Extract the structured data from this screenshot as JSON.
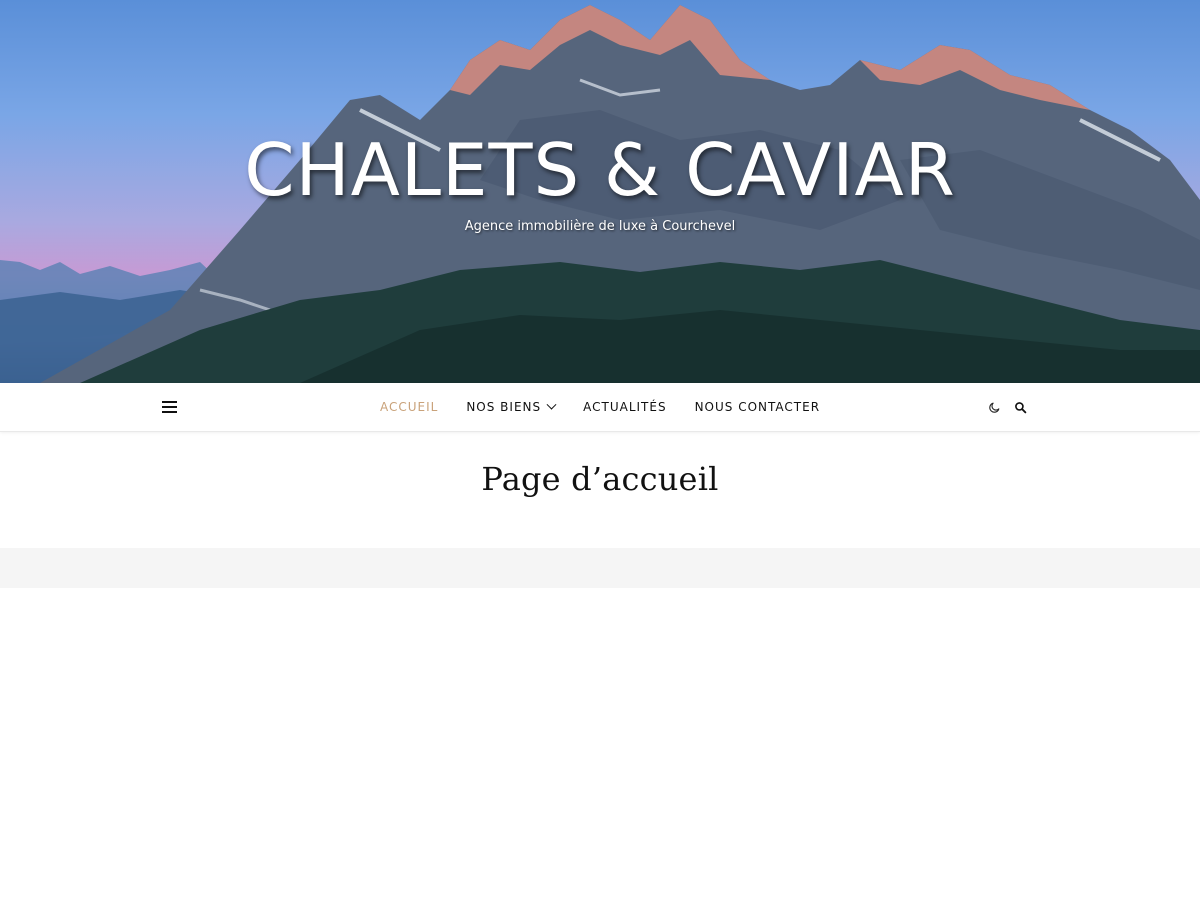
{
  "hero": {
    "site_title": "CHALETS & CAVIAR",
    "tagline": "Agence immobilière de luxe à Courchevel",
    "background_image": "mountain-landscape"
  },
  "nav": {
    "menu_icon": "hamburger-icon",
    "items": [
      {
        "label": "ACCUEIL",
        "active": true
      },
      {
        "label": "NOS BIENS",
        "has_dropdown": true
      },
      {
        "label": "ACTUALITÉS"
      },
      {
        "label": "NOUS CONTACTER"
      }
    ],
    "right_icons": [
      "moon-icon",
      "search-icon"
    ]
  },
  "page": {
    "title": "Page d’accueil"
  },
  "colors": {
    "accent": "#c9a27a",
    "text": "#111111",
    "band": "#f5f5f5"
  }
}
